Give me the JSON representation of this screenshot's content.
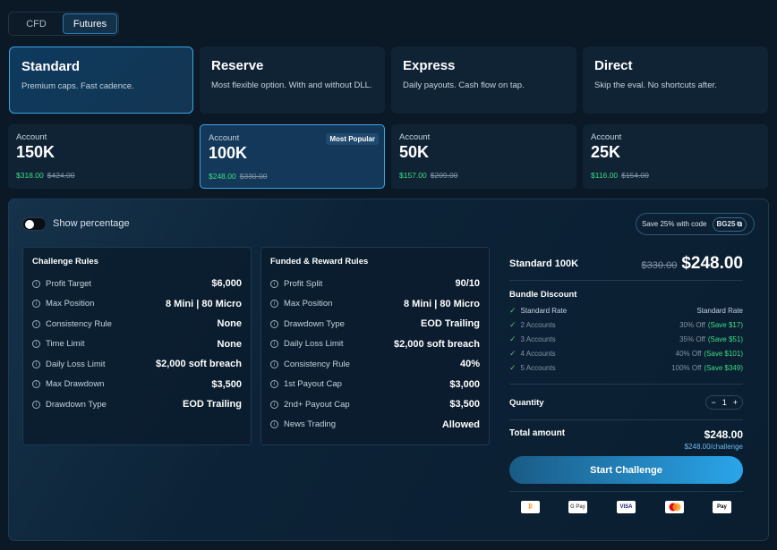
{
  "tabs": [
    "CFD",
    "Futures"
  ],
  "plans": [
    {
      "title": "Standard",
      "desc": "Premium caps. Fast cadence."
    },
    {
      "title": "Reserve",
      "desc": "Most flexible option. With and without DLL."
    },
    {
      "title": "Express",
      "desc": "Daily payouts. Cash flow on tap."
    },
    {
      "title": "Direct",
      "desc": "Skip the eval. No shortcuts after."
    }
  ],
  "accounts": [
    {
      "label": "Account",
      "size": "150K",
      "price": "$318.00",
      "old": "$424.00"
    },
    {
      "label": "Account",
      "size": "100K",
      "price": "$248.00",
      "old": "$330.00",
      "badge": "Most Popular"
    },
    {
      "label": "Account",
      "size": "50K",
      "price": "$157.00",
      "old": "$209.00"
    },
    {
      "label": "Account",
      "size": "25K",
      "price": "$116.00",
      "old": "$154.00"
    }
  ],
  "show_percentage": "Show percentage",
  "promo": {
    "text": "Save 25% with code",
    "code": "BG25"
  },
  "challenge_rules": {
    "title": "Challenge Rules",
    "rows": [
      {
        "label": "Profit Target",
        "value": "$6,000"
      },
      {
        "label": "Max Position",
        "value": "8 Mini | 80 Micro"
      },
      {
        "label": "Consistency Rule",
        "value": "None"
      },
      {
        "label": "Time Limit",
        "value": "None"
      },
      {
        "label": "Daily Loss Limit",
        "value": "$2,000 soft breach"
      },
      {
        "label": "Max Drawdown",
        "value": "$3,500"
      },
      {
        "label": "Drawdown Type",
        "value": "EOD Trailing"
      }
    ]
  },
  "funded_rules": {
    "title": "Funded & Reward Rules",
    "rows": [
      {
        "label": "Profit Split",
        "value": "90/10"
      },
      {
        "label": "Max Position",
        "value": "8 Mini | 80 Micro"
      },
      {
        "label": "Drawdown Type",
        "value": "EOD Trailing"
      },
      {
        "label": "Daily Loss Limit",
        "value": "$2,000 soft breach"
      },
      {
        "label": "Consistency Rule",
        "value": "40%"
      },
      {
        "label": "1st Payout Cap",
        "value": "$3,000"
      },
      {
        "label": "2nd+ Payout Cap",
        "value": "$3,500"
      },
      {
        "label": "News Trading",
        "value": "Allowed"
      }
    ]
  },
  "summary": {
    "product": "Standard 100K",
    "old_price": "$330.00",
    "price": "$248.00",
    "bundle_title": "Bundle Discount",
    "bundle": [
      {
        "label": "Standard Rate",
        "value": "Standard Rate",
        "save": ""
      },
      {
        "label": "2 Accounts",
        "value": "30% Off",
        "save": "(Save $17)"
      },
      {
        "label": "3 Accounts",
        "value": "35% Off",
        "save": "(Save $51)"
      },
      {
        "label": "4 Accounts",
        "value": "40% Off",
        "save": "(Save $101)"
      },
      {
        "label": "5 Accounts",
        "value": "100% Off",
        "save": "(Save $349)"
      }
    ],
    "quantity_label": "Quantity",
    "quantity": "1",
    "total_label": "Total amount",
    "total": "$248.00",
    "per": "$248.00/challenge",
    "cta": "Start Challenge"
  },
  "payments": [
    {
      "name": "bitcoin-icon",
      "text": "₿",
      "bg": "#ffffff",
      "fg": "#f7931a"
    },
    {
      "name": "google-pay-icon",
      "text": "G Pay",
      "bg": "#ffffff",
      "fg": "#5f6368"
    },
    {
      "name": "visa-icon",
      "text": "VISA",
      "bg": "#ffffff",
      "fg": "#1a1f71"
    },
    {
      "name": "mastercard-icon",
      "text": "",
      "bg": "#ffffff",
      "fg": "#000000"
    },
    {
      "name": "apple-pay-icon",
      "text": "Pay",
      "bg": "#ffffff",
      "fg": "#000000"
    }
  ]
}
